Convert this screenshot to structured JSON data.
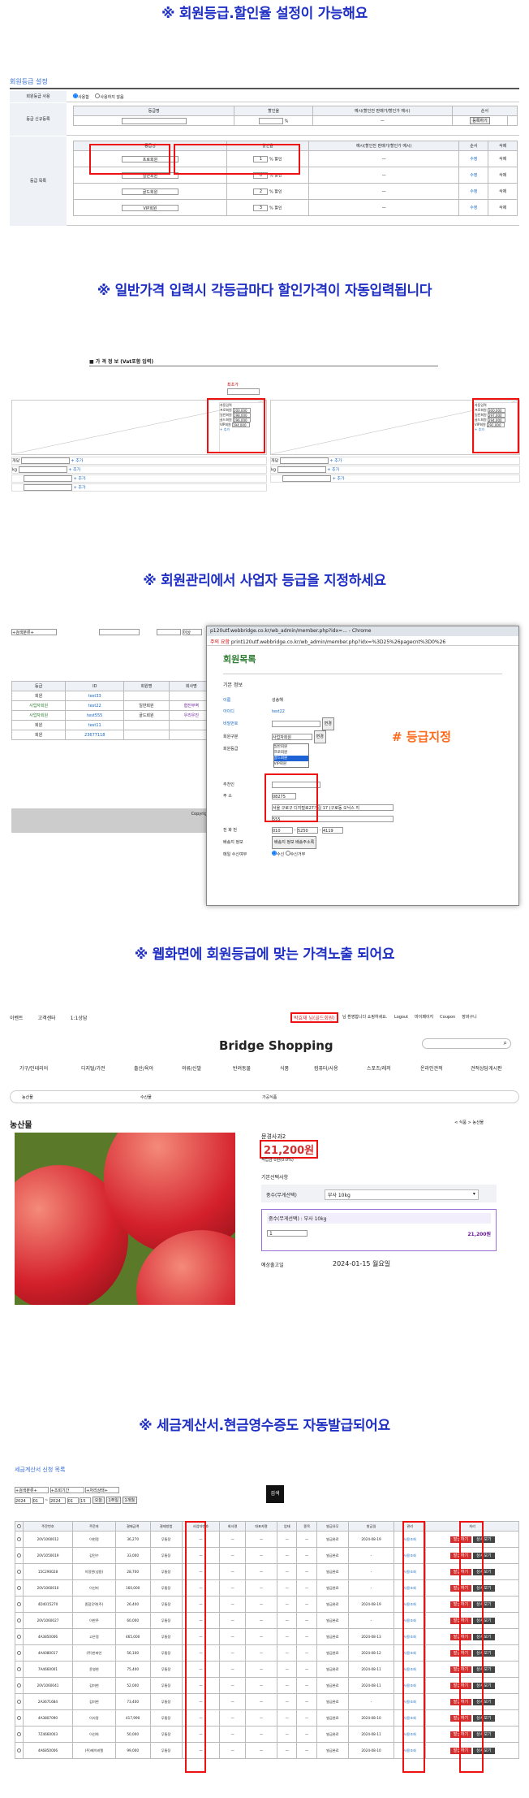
{
  "headings": [
    "※ 회원등급.할인율 설정이 가능해요",
    "※ 일반가격 입력시 각등급마다 할인가격이 자동입력됩니다",
    "※ 회원관리에서 사업자 등급을 지정하세요",
    "※ 웹화면에 회원등급에 맞는 가격노출 되어요",
    "※ 세금계산서.현금영수증도 자동발급되어요"
  ],
  "s1": {
    "title": "회원등급 설정",
    "row1_label": "회원등급 사용",
    "use": "사용함",
    "nouse": "사용하지 않음",
    "row2_label": "등급 신규등록",
    "row3_label": "등급 목록",
    "headers": [
      "등급명",
      "할인율",
      "예시(할인전 판매가/할인가 예시)",
      "순서",
      "삭제"
    ],
    "grades": [
      {
        "name": "프로회원",
        "rate": "1"
      },
      {
        "name": "일반회원",
        "rate": "0"
      },
      {
        "name": "골드회원",
        "rate": "2"
      },
      {
        "name": "VIP회원",
        "rate": "3"
      }
    ],
    "modify": "수정",
    "delete": "삭제",
    "register": "등록하기"
  },
  "s2": {
    "title": "■ 가 격 정 보 (Vat포함 입력)",
    "first_label": "최초가",
    "grade_box": [
      "자동입력",
      "프로회원",
      "일반회원",
      "골드회원",
      "VIP회원"
    ],
    "prices_left": [
      "200,000",
      "198,000",
      "196,000",
      "194,000"
    ],
    "prices_right": [
      "300,000",
      "297,000",
      "294,000",
      "291,000"
    ],
    "row_labels": [
      "개당",
      "kg"
    ],
    "add": "+ 추가"
  },
  "s3": {
    "search_sel": "+검색분류+",
    "sel2": "이상",
    "table_headers": [
      "등급",
      "ID",
      "회원명",
      "회사명"
    ],
    "rows": [
      {
        "grade": "회원",
        "id": "test33",
        "name": "",
        "company": ""
      },
      {
        "grade": "사업자회원",
        "id": "test22",
        "name": "일반회원",
        "company": "협진무역"
      },
      {
        "grade": "사업자회원",
        "id": "test555",
        "name": "골드회원",
        "company": "우리우진"
      },
      {
        "grade": "회원",
        "id": "test11",
        "name": "",
        "company": ""
      },
      {
        "grade": "회원",
        "id": "23677118",
        "name": "",
        "company": ""
      }
    ],
    "copyright": "Copyright",
    "window_title": "p120utf.webbridge.co.kr/wb_admin/member.php?idx=... - Chrome",
    "not_secure": "주의 요함",
    "url": "print120utf.webbridge.co.kr/wb_admin/member.php?idx=%3D25%26pagecnt%3D0%26",
    "popup_heading": "회원목록",
    "basic_info": "기본 정보",
    "fields": [
      "이름",
      "아이디",
      "비밀번호",
      "회원구분",
      "회원등급",
      "추천인",
      "주 소",
      "전 화 번",
      "배송지 정보",
      "메일 수신여부"
    ],
    "name_value": "성송해",
    "id_value": "test22",
    "gubun_value": "사업자회원",
    "grade_options": [
      "일반회원",
      "프로회원",
      "골드회원",
      "VIP회원"
    ],
    "address_value": "서울 구로구 디지털로27가길 17 (구로동 오닉스 지",
    "zip": "08275",
    "detail": "555",
    "phone": [
      "010",
      "5250",
      "4119"
    ],
    "change": "변경",
    "annotation": "# 등급지정",
    "shipping_btn": "배송지 정보 배송주소록",
    "mail": [
      "수신",
      "수신거부"
    ]
  },
  "s4": {
    "topnav": [
      "이벤트",
      "고객센터",
      "1:1상담"
    ],
    "user_badge": "박효재 님(골드회원)",
    "welcome": "님 환영합니다 쇼핑하세요.",
    "links": [
      "Logout",
      "마이페이지",
      "Coupon",
      "장바구니"
    ],
    "logo": "Bridge Shopping",
    "categories": [
      "가구/인테리어",
      "디지털/가전",
      "출산/육아",
      "의류/신발",
      "반려동물",
      "식품",
      "컴퓨터/사용",
      "스포츠/레저",
      "온라인견적",
      "견적상담게시판"
    ],
    "subcats": [
      "농산물",
      "수산물",
      "가공식품"
    ],
    "page_title": "농산물",
    "breadcrumb": "식품 > 농산물",
    "product_name": "문경사과2",
    "price": "21,200원",
    "sub_price": "적립금 0원(0.0%)",
    "option_label": "기본선택사항",
    "option_name": "중수(무게선택)",
    "option_value": "부사 10kg",
    "selected_label": "중수(무게선택) : 부사 10kg",
    "qty": "1",
    "selected_price": "21,200원",
    "ship_label": "예상출고일",
    "ship_date": "2024-01-15 월요일"
  },
  "s5": {
    "title": "세금계산서 신청 목록",
    "filters": [
      "+검색분류+",
      "+조회기간",
      "+처리상태+"
    ],
    "dates": [
      "2024",
      "01",
      "2024",
      "01",
      "15"
    ],
    "buttons": [
      "오늘",
      "1주일",
      "1개월"
    ],
    "search_btn": "검색",
    "headers": [
      "주문번호",
      "주문자",
      "결제금액",
      "결제방법",
      "사업자번호",
      "회사명",
      "대표자명",
      "업태",
      "종목",
      "발급유무",
      "발급일",
      "관리",
      "처리"
    ],
    "rows": [
      {
        "no": "20V1060012",
        "who": "이현정",
        "amt": "36,270",
        "m": "무통장",
        "st": "발급완료",
        "date": "2024-08-19"
      },
      {
        "no": "20V1050019",
        "who": "김민수",
        "amt": "33,000",
        "m": "무통장",
        "st": "발급완료",
        "date": "-"
      },
      {
        "no": "15C290028",
        "who": "이정한(성용)",
        "amt": "28,700",
        "m": "무통장",
        "st": "발급완료",
        "date": "-"
      },
      {
        "no": "20V1060010",
        "who": "이선미",
        "amt": "160,000",
        "m": "무통장",
        "st": "발급완료",
        "date": "-"
      },
      {
        "no": "4D4015270",
        "who": "종합무역(주)",
        "amt": "26,400",
        "m": "무통장",
        "st": "발급완료",
        "date": "2024-08-19"
      },
      {
        "no": "20V1060027",
        "who": "이한주",
        "amt": "60,000",
        "m": "무통장",
        "st": "발급완료",
        "date": "-"
      },
      {
        "no": "4A3850006",
        "who": "고은정",
        "amt": "465,000",
        "m": "무통장",
        "st": "발급완료",
        "date": "2024-08-13"
      },
      {
        "no": "4A4080017",
        "who": "(주)한파언",
        "amt": "56,100",
        "m": "무통장",
        "st": "발급완료",
        "date": "2024-08-12"
      },
      {
        "no": "7A4660001",
        "who": "윤영현",
        "amt": "75,400",
        "m": "무통장",
        "st": "발급완료",
        "date": "2024-08-11"
      },
      {
        "no": "20V1060041",
        "who": "김미현",
        "amt": "52,000",
        "m": "무통장",
        "st": "발급완료",
        "date": "2024-08-11"
      },
      {
        "no": "2A3671684",
        "who": "김미현",
        "amt": "73,400",
        "m": "무통장",
        "st": "발급완료",
        "date": "-"
      },
      {
        "no": "4A3807090",
        "who": "이사랑",
        "amt": "417,990",
        "m": "무통장",
        "st": "발급완료",
        "date": "2024-08-10"
      },
      {
        "no": "7Z4660003",
        "who": "이선희",
        "amt": "50,000",
        "m": "무통장",
        "st": "발급완료",
        "date": "2024-08-11"
      },
      {
        "no": "4A6850006",
        "who": "(주)제이비엘",
        "amt": "99,000",
        "m": "무통장",
        "st": "발급완료",
        "date": "2024-08-10"
      }
    ],
    "issue_btn": "발급하기",
    "detail_btn": "상세보기",
    "modify_btn": "사용조회"
  }
}
